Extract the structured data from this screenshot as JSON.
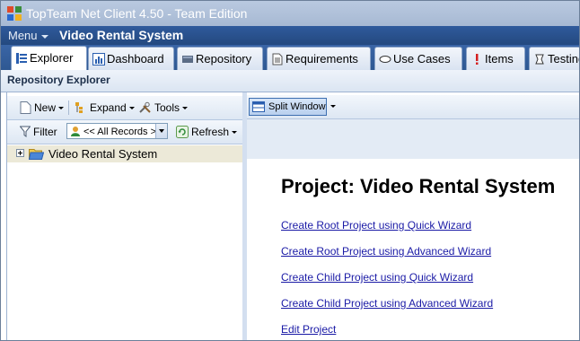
{
  "window": {
    "title": "TopTeam Net Client 4.50 - Team Edition"
  },
  "menubar": {
    "menu_label": "Menu",
    "project_name": "Video Rental System"
  },
  "tabs": [
    {
      "label": "Explorer",
      "icon": "explorer-icon",
      "active": true
    },
    {
      "label": "Dashboard",
      "icon": "dashboard-icon",
      "active": false
    },
    {
      "label": "Repository",
      "icon": "repository-icon",
      "active": false
    },
    {
      "label": "Requirements",
      "icon": "requirements-icon",
      "active": false
    },
    {
      "label": "Use Cases",
      "icon": "use-cases-icon",
      "active": false
    },
    {
      "label": "Items",
      "icon": "items-icon",
      "active": false
    },
    {
      "label": "Testing",
      "icon": "testing-icon",
      "active": false
    }
  ],
  "panel": {
    "title": "Repository Explorer"
  },
  "left_toolbar": {
    "new_label": "New",
    "expand_label": "Expand",
    "tools_label": "Tools",
    "filter_label": "Filter",
    "filter_value": "<< All Records >>",
    "refresh_label": "Refresh"
  },
  "tree": {
    "root_label": "Video Rental System"
  },
  "right_toolbar": {
    "split_window_label": "Split Window"
  },
  "project": {
    "heading": "Project: Video Rental System",
    "links": [
      "Create Root Project using Quick Wizard",
      "Create Root Project using Advanced Wizard",
      "Create Child Project using Quick Wizard",
      "Create Child Project using Advanced Wizard",
      "Edit Project"
    ]
  },
  "colors": {
    "menubar": "#2f5a9c",
    "tree_selection": "#ece9d8",
    "link": "#1a1aa6"
  }
}
